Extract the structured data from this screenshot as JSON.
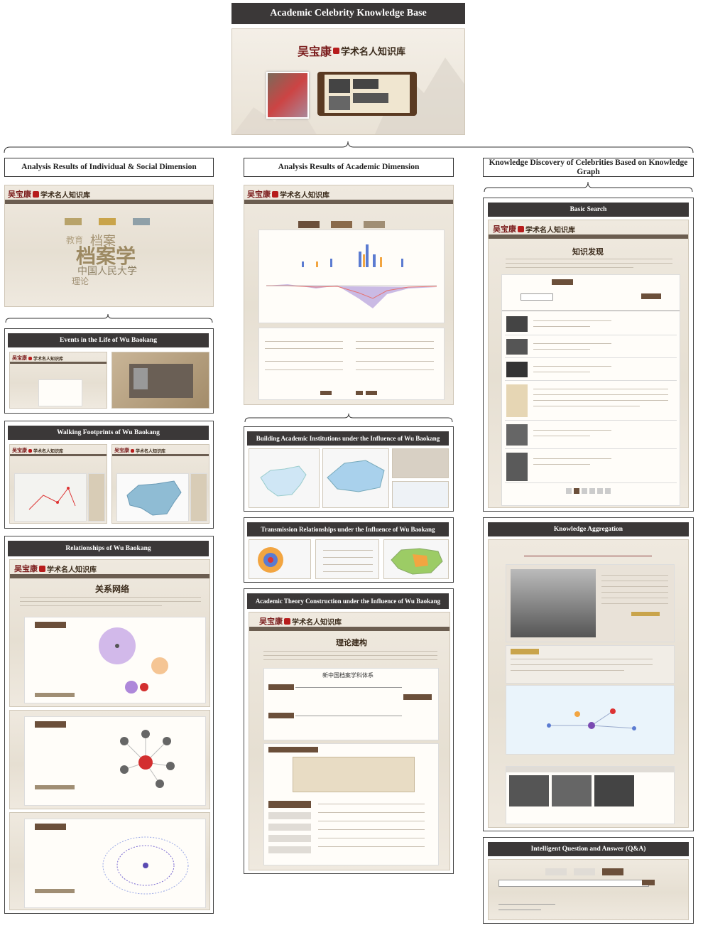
{
  "header": {
    "title": "Academic Celebrity Knowledge Base"
  },
  "logo": {
    "name": "吴宝康",
    "subtitle": "学术名人知识库"
  },
  "columns": [
    {
      "title": "Analysis Results of Individual & Social Dimension"
    },
    {
      "title": "Analysis Results of Academic Dimension"
    },
    {
      "title": "Knowledge Discovery of Celebrities Based on Knowledge Graph"
    }
  ],
  "individual": {
    "wordcloud": [
      "档案学",
      "档案",
      "中国人民大学",
      "理论",
      "教育"
    ],
    "sections": [
      {
        "title": "Events in the Life of Wu Baokang"
      },
      {
        "title": "Walking Footprints of Wu Baokang"
      },
      {
        "title": "Relationships of Wu Baokang",
        "heading": "关系网络"
      }
    ]
  },
  "academic": {
    "sections": [
      {
        "title": "Building Academic Institutions under the Influence of Wu Baokang"
      },
      {
        "title": "Transmission Relationships under the Influence of Wu Baokang"
      },
      {
        "title": "Academic Theory Construction under the Influence of Wu Baokang",
        "heading": "理论建构",
        "diagram_title": "新中国档案学科体系"
      }
    ]
  },
  "discovery": {
    "sections": [
      {
        "title": "Basic Search",
        "heading": "知识发现"
      },
      {
        "title": "Knowledge Aggregation"
      },
      {
        "title": "Intelligent Question and Answer (Q&A)"
      }
    ]
  }
}
